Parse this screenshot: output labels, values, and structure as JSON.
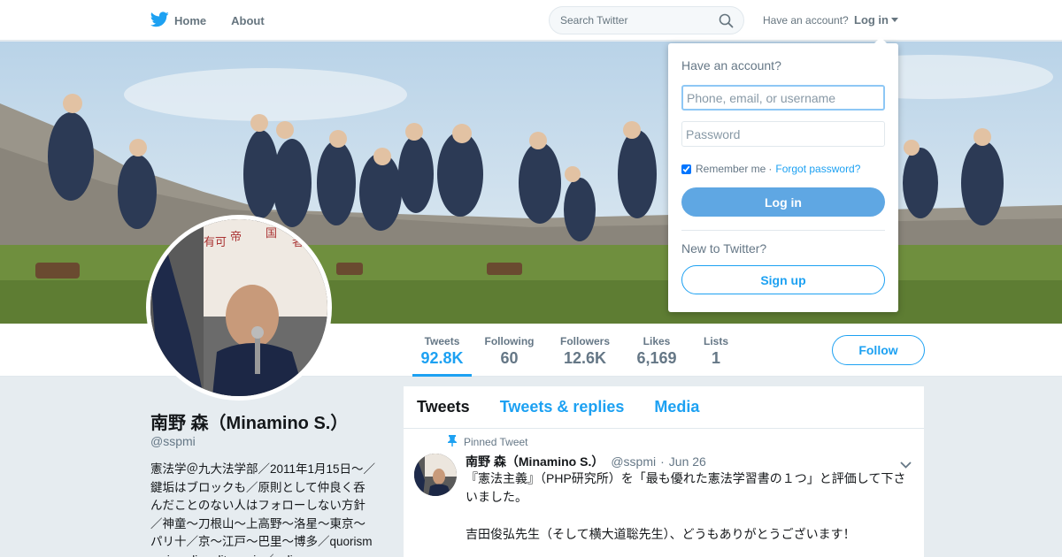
{
  "nav": {
    "home_label": "Home",
    "about_label": "About",
    "search_placeholder": "Search Twitter",
    "account_prompt": "Have an account?",
    "login_label": "Log in"
  },
  "profile_nav": {
    "stats": [
      {
        "label": "Tweets",
        "value": "92.8K"
      },
      {
        "label": "Following",
        "value": "60"
      },
      {
        "label": "Followers",
        "value": "12.6K"
      },
      {
        "label": "Likes",
        "value": "6,169"
      },
      {
        "label": "Lists",
        "value": "1"
      }
    ],
    "follow_label": "Follow"
  },
  "profile": {
    "name": "南野 森（Minamino S.）",
    "handle": "@sspmi",
    "bio": "憲法学＠九大法学部／2011年1月15日～／鍵垢はブロックも／原則として仲良く呑んだことのない人はフォローしない方針／神童～刀根山～上高野～洛星～東京～パリ十／京～江戸～巴里～博多／quorism curia seli audit omnis／neli"
  },
  "timeline": {
    "tabs": [
      "Tweets",
      "Tweets & replies",
      "Media"
    ],
    "pinned_label": "Pinned Tweet",
    "tweet": {
      "name": "南野 森（Minamino S.）",
      "handle": "@sspmi",
      "date": "Jun 26",
      "line1": "『憲法主義』（PHP研究所）を「最も優れた憲法学習書の１つ」と評価して下さいました。",
      "line2": "吉田俊弘先生（そして横大道聡先生）、どうもありがとうございます！"
    }
  },
  "login_dropdown": {
    "title": "Have an account?",
    "username_placeholder": "Phone, email, or username",
    "password_placeholder": "Password",
    "remember_label": "Remember me",
    "separator": "·",
    "forgot_label": "Forgot password?",
    "login_button": "Log in",
    "new_prompt": "New to Twitter?",
    "signup_button": "Sign up"
  },
  "colors": {
    "brand": "#1da1f2",
    "login_button": "#5fa7e3",
    "page_background": "#e6ecf0"
  }
}
